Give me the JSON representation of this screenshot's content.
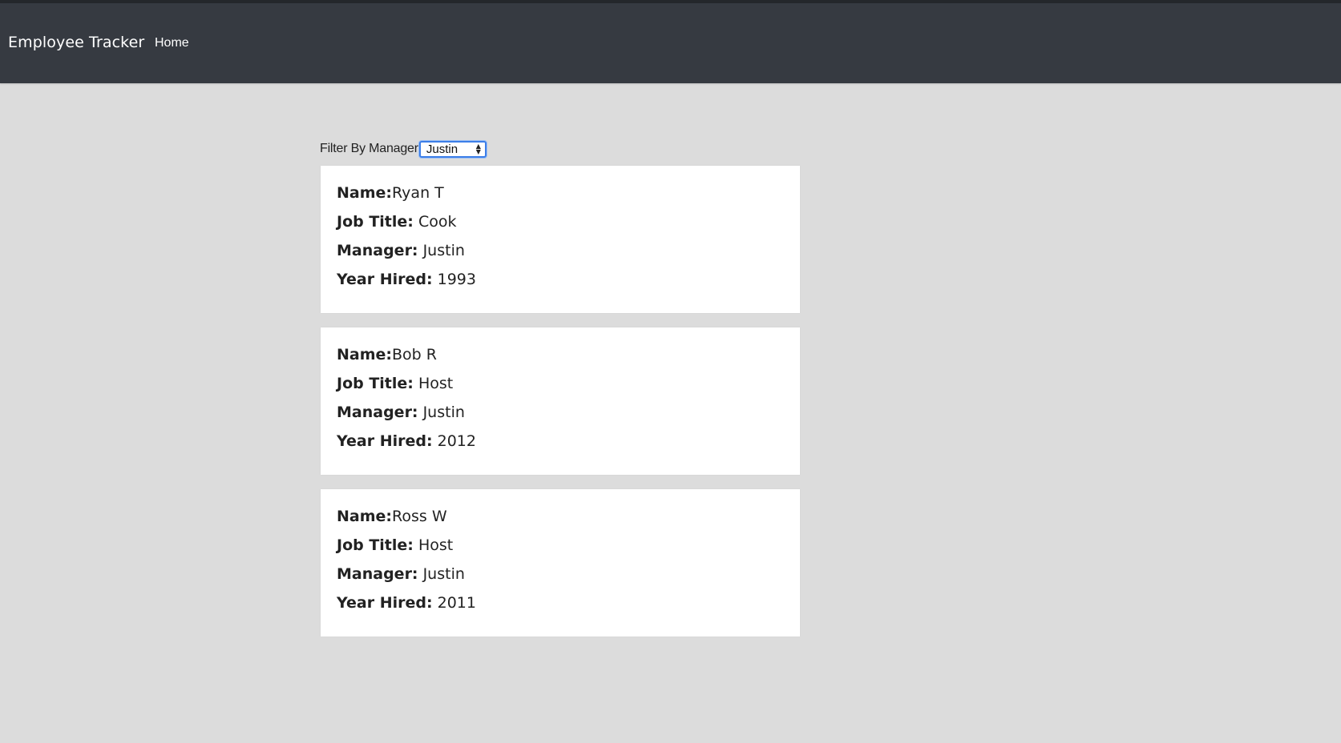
{
  "navbar": {
    "brand": "Employee Tracker",
    "links": [
      {
        "label": "Home"
      }
    ]
  },
  "filter": {
    "label": "Filter By Manager",
    "selected": "Justin"
  },
  "labels": {
    "name": "Name:",
    "job_title": "Job Title:",
    "manager": "Manager:",
    "year_hired": "Year Hired:"
  },
  "employees": [
    {
      "name": "Ryan T",
      "job_title": "Cook",
      "manager": "Justin",
      "year_hired": "1993"
    },
    {
      "name": "Bob R",
      "job_title": "Host",
      "manager": "Justin",
      "year_hired": "2012"
    },
    {
      "name": "Ross W",
      "job_title": "Host",
      "manager": "Justin",
      "year_hired": "2011"
    }
  ],
  "colors": {
    "navbar": "#363a41",
    "page_background": "#dcdcdc",
    "card_background": "#ffffff",
    "focus_ring": "#3c7ee8"
  }
}
